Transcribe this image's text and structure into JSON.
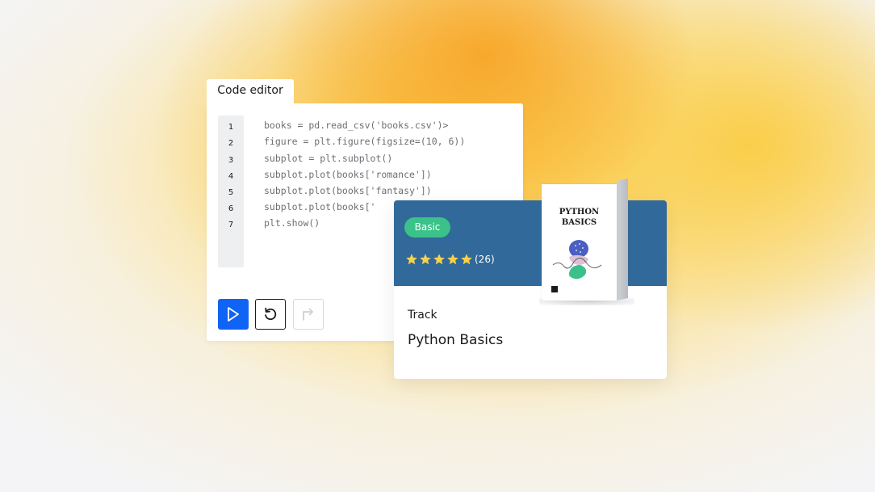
{
  "editor": {
    "tab_label": "Code editor",
    "line_numbers": [
      "1",
      "2",
      "3",
      "4",
      "5",
      "6",
      "7"
    ],
    "code_lines": [
      "books = pd.read_csv('books.csv')>",
      "figure = plt.figure(figsize=(10, 6))",
      "subplot = plt.subplot()",
      "subplot.plot(books['romance'])",
      "subplot.plot(books['fantasy'])",
      "subplot.plot(books['",
      "plt.show()"
    ],
    "buttons": [
      {
        "name": "run-button",
        "icon": "play-icon"
      },
      {
        "name": "reset-button",
        "icon": "undo-icon"
      },
      {
        "name": "redo-button",
        "icon": "redo-icon",
        "disabled": true
      }
    ]
  },
  "card": {
    "badge": "Basic",
    "rating": 5,
    "rating_max": 5,
    "rating_count": "(26)",
    "type": "Track",
    "title": "Python Basics",
    "book_cover_title": "PYTHON BASICS"
  },
  "colors": {
    "run_button": "#0f63f5",
    "badge": "#3ac288",
    "card_header": "#31699a",
    "star": "#f8d14c"
  }
}
